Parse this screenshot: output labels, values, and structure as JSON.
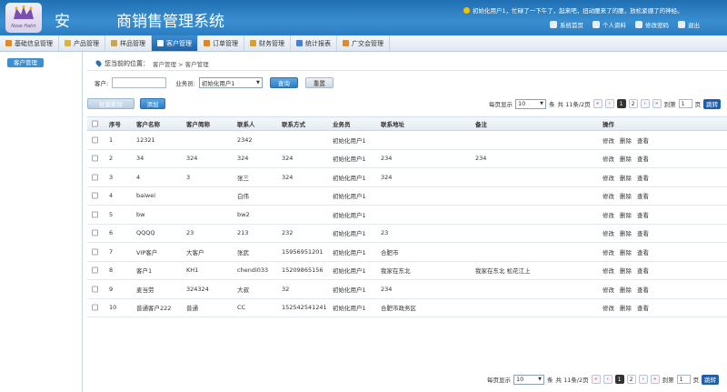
{
  "app": {
    "title": "安　　　商销售管理系统",
    "logo_text": "Nose Hatin"
  },
  "header": {
    "welcome": "初始化用户1，忙碌了一下午了，起来吧，扭动腰来了的腰，放松紧绷了的神经。",
    "links": [
      {
        "label": "系统首页",
        "icon": "home-icon"
      },
      {
        "label": "个人资料",
        "icon": "profile-icon"
      },
      {
        "label": "修改密码",
        "icon": "key-icon"
      },
      {
        "label": "退出",
        "icon": "logout-icon"
      }
    ]
  },
  "nav": {
    "items": [
      {
        "label": "基础信息管理",
        "icon": "info-icon",
        "color": "#e08a2b",
        "active": false
      },
      {
        "label": "产品管理",
        "icon": "product-icon",
        "color": "#e0b23a",
        "active": false
      },
      {
        "label": "样品管理",
        "icon": "sample-icon",
        "color": "#c9a45a",
        "active": false
      },
      {
        "label": "客户管理",
        "icon": "customer-icon",
        "color": "#ffffff",
        "active": true
      },
      {
        "label": "订单管理",
        "icon": "order-icon",
        "color": "#d9862e",
        "active": false
      },
      {
        "label": "财务管理",
        "icon": "finance-icon",
        "color": "#d9a02e",
        "active": false
      },
      {
        "label": "统计报表",
        "icon": "chart-icon",
        "color": "#4a7fd0",
        "active": false
      },
      {
        "label": "广交会管理",
        "icon": "fair-icon",
        "color": "#e08a2b",
        "active": false
      }
    ]
  },
  "sidebar": {
    "active_label": "客户管理"
  },
  "breadcrumb": {
    "prefix": "您当前的位置：",
    "path": "客户管理 > 客户管理"
  },
  "search": {
    "customer_label": "客户:",
    "customer_value": "",
    "salesman_label": "业务员:",
    "salesman_value": "初始化用户1",
    "query_label": "查询",
    "reset_label": "重置"
  },
  "toolbar": {
    "batch_delete_label": "批量删除",
    "add_label": "添加"
  },
  "pager": {
    "per_page_label": "每页显示",
    "per_page_value": "10",
    "unit_label": "条",
    "summary": "共 11条/2页",
    "pages": [
      "1",
      "2"
    ],
    "current_page": "1",
    "goto_label": "到第",
    "goto_value": "1",
    "page_unit": "页",
    "go_label": "跳转"
  },
  "table": {
    "headers": [
      "序号",
      "客户名称",
      "客户简称",
      "联系人",
      "联系方式",
      "业务员",
      "联系地址",
      "备注",
      "操作"
    ],
    "op_labels": [
      "修改",
      "删除",
      "查看"
    ],
    "rows": [
      [
        "1",
        "12321",
        "",
        "2342",
        "",
        "初始化用户1",
        "",
        ""
      ],
      [
        "2",
        "34",
        "324",
        "324",
        "324",
        "初始化用户1",
        "234",
        "234"
      ],
      [
        "3",
        "4",
        "3",
        "张三",
        "324",
        "初始化用户1",
        "324",
        ""
      ],
      [
        "4",
        "baiwei",
        "",
        "白伟",
        "",
        "初始化用户1",
        "",
        ""
      ],
      [
        "5",
        "bw",
        "",
        "bw2",
        "",
        "初始化用户1",
        "",
        ""
      ],
      [
        "6",
        "QQQQ",
        "23",
        "213",
        "232",
        "初始化用户1",
        "23",
        ""
      ],
      [
        "7",
        "VIP客户",
        "大客户",
        "张武",
        "15956951201",
        "初始化用户1",
        "合肥市",
        ""
      ],
      [
        "8",
        "客户1",
        "KH1",
        "chendi033",
        "15209865156",
        "初始化用户1",
        "我家在东北",
        "我家在东北 松花江上"
      ],
      [
        "9",
        "麦当劳",
        "324324",
        "大叔",
        "32",
        "初始化用户1",
        "234",
        ""
      ],
      [
        "10",
        "普通客户222",
        "普通",
        "CC",
        "15254254124​1",
        "初始化用户1",
        "合肥市政务区",
        ""
      ]
    ]
  }
}
